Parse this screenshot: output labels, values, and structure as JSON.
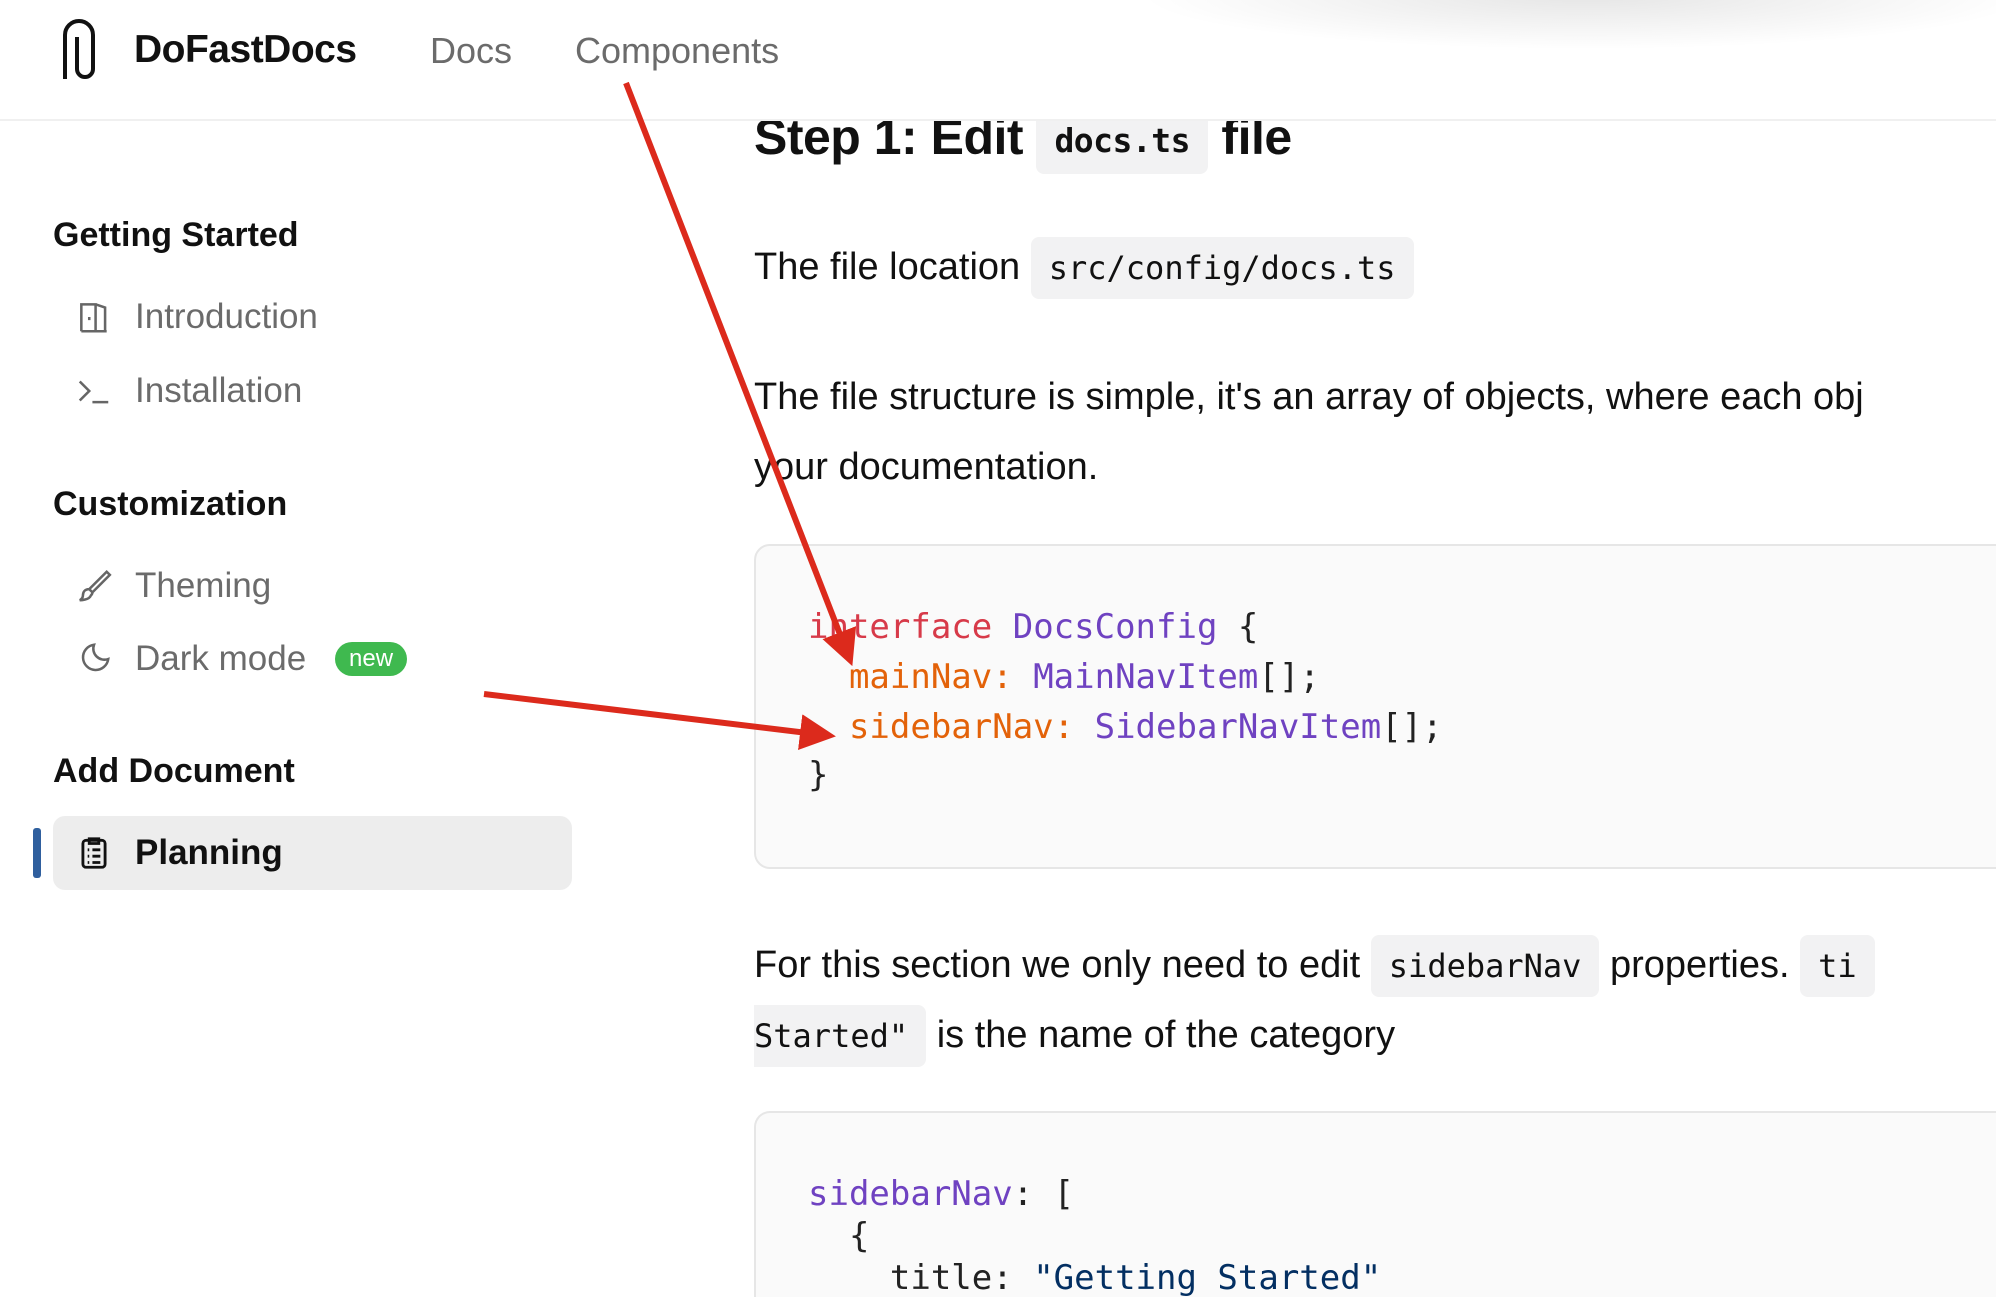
{
  "header": {
    "brand": "DoFastDocs",
    "logo_icon": "paperclip-icon",
    "nav": [
      {
        "label": "Docs"
      },
      {
        "label": "Components"
      }
    ]
  },
  "sidebar": {
    "sections": [
      {
        "title": "Getting Started",
        "items": [
          {
            "label": "Introduction",
            "icon": "book-open-icon"
          },
          {
            "label": "Installation",
            "icon": "terminal-icon"
          }
        ]
      },
      {
        "title": "Customization",
        "items": [
          {
            "label": "Theming",
            "icon": "brush-icon"
          },
          {
            "label": "Dark mode",
            "icon": "moon-icon",
            "badge": "new"
          }
        ]
      },
      {
        "title": "Add Document",
        "items": [
          {
            "label": "Planning",
            "icon": "clipboard-icon",
            "active": true
          }
        ]
      }
    ],
    "badge_color": "#3fb94f",
    "active_indicator_color": "#2f5f9e"
  },
  "main": {
    "heading": {
      "pre": "Step 1: Edit",
      "code": "docs.ts",
      "post": "file"
    },
    "location": {
      "text": "The file location",
      "code": "src/config/docs.ts"
    },
    "structure": {
      "line1": "The file structure is simple, it's an array of objects, where each obj",
      "line2": "your documentation."
    },
    "code1": {
      "l1_kw": "interface",
      "l1_type": "DocsConfig",
      "l1_rest": " {",
      "l2_prop": "mainNav:",
      "l2_type": "MainNavItem",
      "l2_rest": "[];",
      "l3_prop": "sidebarNav:",
      "l3_type": "SidebarNavItem",
      "l3_rest": "[];",
      "l4": "}"
    },
    "section": {
      "text1": "For this section we only need to edit",
      "code1": "sidebarNav",
      "text2": "properties.",
      "code2": "ti",
      "code3": "Started\"",
      "text3": "is the name of the category"
    },
    "code2": {
      "l1_type": "sidebarNav",
      "l1_rest": ": [",
      "l2": "{",
      "l3_prop": "title: ",
      "l3_str": "\"Getting Started\""
    }
  },
  "annotations": {
    "arrow_color": "#dc2a1c"
  }
}
